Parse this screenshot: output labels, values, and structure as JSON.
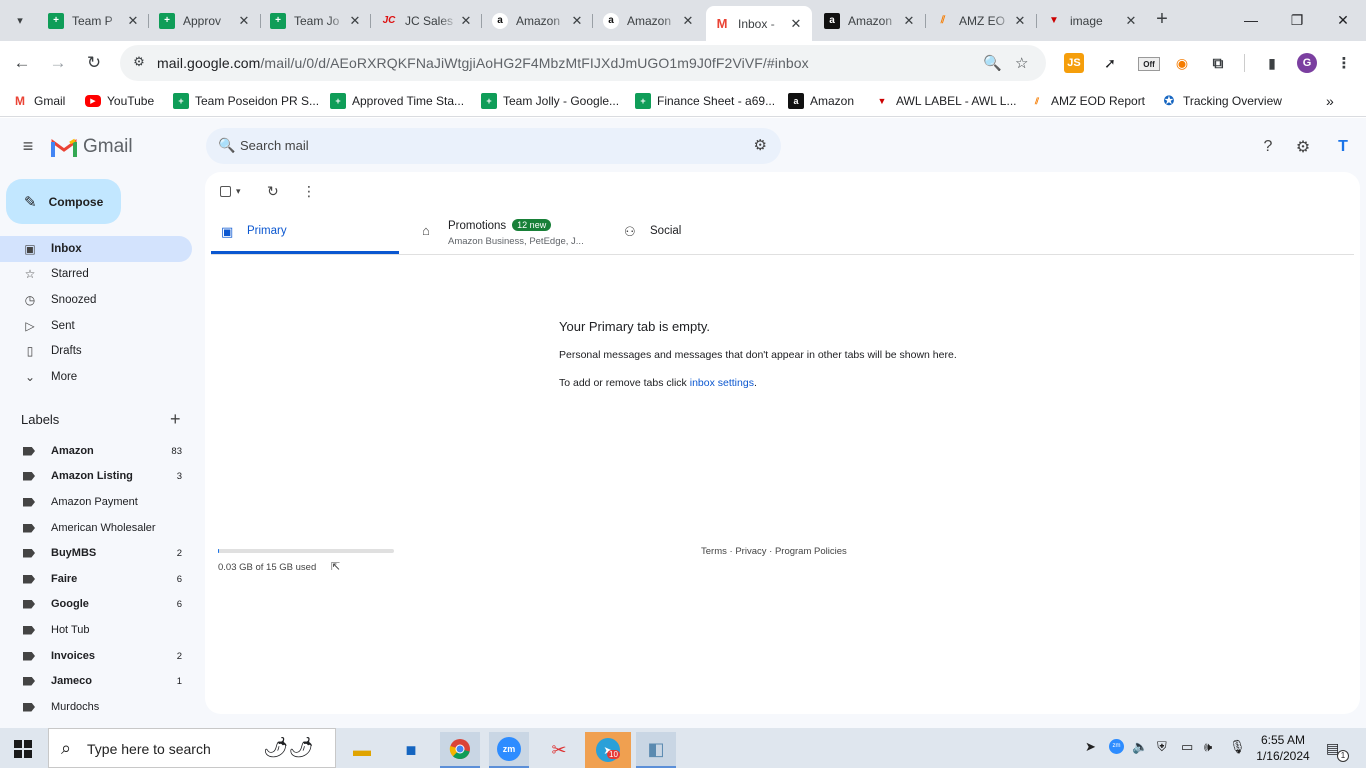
{
  "browser": {
    "tabs": [
      {
        "title": "Team P",
        "icon": "sheets-icon"
      },
      {
        "title": "Approv",
        "icon": "sheets-icon"
      },
      {
        "title": "Team Jo",
        "icon": "sheets-icon"
      },
      {
        "title": "JC Sales",
        "icon": "jc-icon"
      },
      {
        "title": "Amazon",
        "icon": "amazon-icon"
      },
      {
        "title": "Amazon",
        "icon": "amazon-icon"
      },
      {
        "title": "Inbox -",
        "icon": "gmail-icon"
      },
      {
        "title": "Amazon",
        "icon": "amazon-dark-icon"
      },
      {
        "title": "AMZ EO",
        "icon": "amz-eod-icon"
      },
      {
        "title": "image",
        "icon": "awl-icon"
      }
    ],
    "url_host": "mail.google.com",
    "url_path": "/mail/u/0/d/AEoRXRQKFNaJiWtgjiAoHG2F4MbzMtFIJXdJmUGO1m9J0fF2ViVF/#inbox",
    "extensions": {
      "js_label": "JS",
      "off_label": "Off",
      "profile_letter": "G"
    },
    "bookmarks": [
      {
        "label": "Gmail",
        "icon": "gmail-icon"
      },
      {
        "label": "YouTube",
        "icon": "youtube-icon"
      },
      {
        "label": "Team Poseidon PR S...",
        "icon": "sheets-icon"
      },
      {
        "label": "Approved Time Sta...",
        "icon": "sheets-icon"
      },
      {
        "label": "Team Jolly - Google...",
        "icon": "sheets-icon"
      },
      {
        "label": "Finance Sheet - a69...",
        "icon": "sheets-icon"
      },
      {
        "label": "Amazon",
        "icon": "amazon-icon"
      },
      {
        "label": "AWL LABEL - AWL L...",
        "icon": "awl-icon"
      },
      {
        "label": "AMZ EOD Report",
        "icon": "amz-eod-icon"
      },
      {
        "label": "Tracking Overview",
        "icon": "tracking-icon"
      }
    ]
  },
  "gmail": {
    "logo_text": "Gmail",
    "search_placeholder": "Search mail",
    "avatar_letter": "T",
    "compose_label": "Compose",
    "nav": [
      {
        "label": "Inbox",
        "icon": "inbox-icon",
        "active": true
      },
      {
        "label": "Starred",
        "icon": "star-icon"
      },
      {
        "label": "Snoozed",
        "icon": "clock-icon"
      },
      {
        "label": "Sent",
        "icon": "send-icon"
      },
      {
        "label": "Drafts",
        "icon": "draft-icon"
      },
      {
        "label": "More",
        "icon": "chevron-down-icon"
      }
    ],
    "labels_title": "Labels",
    "labels": [
      {
        "name": "Amazon",
        "count": "83",
        "bold": true
      },
      {
        "name": "Amazon Listing",
        "count": "3",
        "bold": true
      },
      {
        "name": "Amazon Payment",
        "count": "",
        "bold": false
      },
      {
        "name": "American Wholesaler",
        "count": "",
        "bold": false
      },
      {
        "name": "BuyMBS",
        "count": "2",
        "bold": true
      },
      {
        "name": "Faire",
        "count": "6",
        "bold": true
      },
      {
        "name": "Google",
        "count": "6",
        "bold": true
      },
      {
        "name": "Hot Tub",
        "count": "",
        "bold": false
      },
      {
        "name": "Invoices",
        "count": "2",
        "bold": true
      },
      {
        "name": "Jameco",
        "count": "1",
        "bold": true
      },
      {
        "name": "Murdochs",
        "count": "",
        "bold": false
      }
    ],
    "tabs": {
      "primary": "Primary",
      "promotions": "Promotions",
      "promotions_badge": "12 new",
      "promotions_sub": "Amazon Business, PetEdge, J...",
      "social": "Social"
    },
    "empty": {
      "title": "Your Primary tab is empty.",
      "line1": "Personal messages and messages that don't appear in other tabs will be shown here.",
      "line2_prefix": "To add or remove tabs click ",
      "line2_link": "inbox settings",
      "line2_suffix": "."
    },
    "storage": {
      "text": "0.03 GB of 15 GB used",
      "fraction": 0.002
    },
    "footer": {
      "terms": "Terms",
      "privacy": "Privacy",
      "policies": "Program Policies",
      "sep": " · "
    }
  },
  "taskbar": {
    "search_placeholder": "Type here to search",
    "time": "6:55 AM",
    "date": "1/16/2024",
    "telegram_badge": "10",
    "notification_count": "1"
  }
}
